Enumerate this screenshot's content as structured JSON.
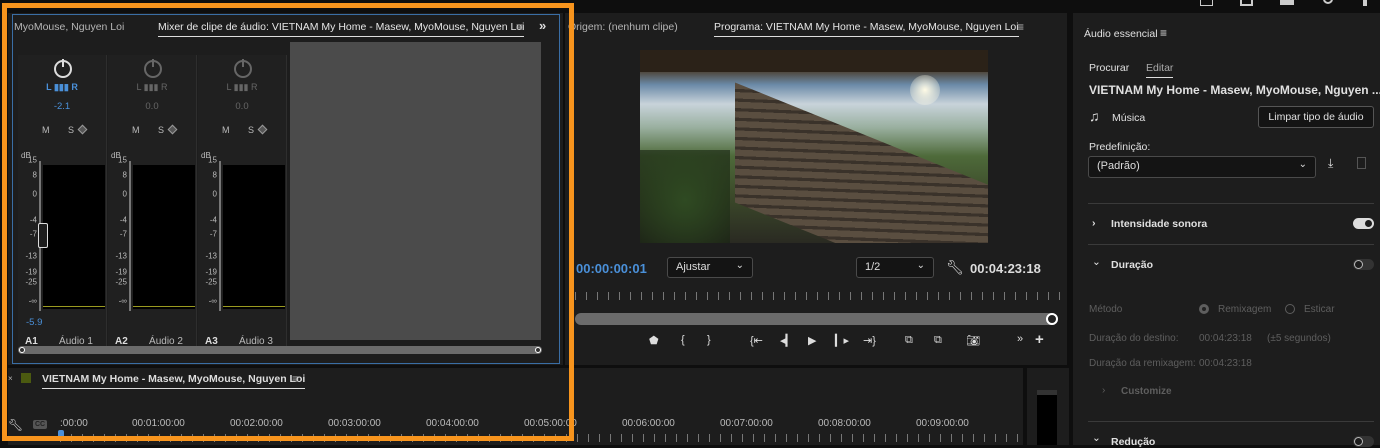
{
  "mixer": {
    "prev_tab": "MyoMouse, Nguyen Loi",
    "active_tab": "Mixer de clipe de áudio: VIETNAM   My Home - Masew, MyoMouse, Nguyen Loi",
    "overflow": "»",
    "db_label": "dB",
    "scale": [
      "15",
      "8",
      "0",
      "-4",
      "-7",
      "-13",
      "-19",
      "-25",
      "-∞"
    ],
    "channels": [
      {
        "id": "A1",
        "name": "Áudio 1",
        "pan": "-2.1",
        "volume": "-5.9",
        "active": true
      },
      {
        "id": "A2",
        "name": "Áudio 2",
        "pan": "0.0",
        "volume": "",
        "active": false
      },
      {
        "id": "A3",
        "name": "Áudio 3",
        "pan": "0.0",
        "volume": "",
        "active": false
      }
    ],
    "lr": "L ▮▮▮ R",
    "ms": "M S"
  },
  "monitor": {
    "source_tab": "Origem: (nenhum clipe)",
    "program_tab": "Programa: VIETNAM   My Home - Masew, MyoMouse, Nguyen Loi",
    "timecode": "00:00:00:01",
    "fit": "Ajustar",
    "resolution": "1/2",
    "duration": "00:04:23:18"
  },
  "timeline": {
    "tab": "VIETNAM   My Home - Masew, MyoMouse, Nguyen Loi",
    "cc": "CC",
    "ruler": [
      ":00:00",
      "00:01:00:00",
      "00:02:00:00",
      "00:03:00:00",
      "00:04:00:00",
      "00:05:00:00",
      "00:06:00:00",
      "00:07:00:00",
      "00:08:00:00",
      "00:09:00:00"
    ]
  },
  "essential": {
    "title": "Áudio essencial",
    "tabs": [
      "Procurar",
      "Editar"
    ],
    "clip": "VIETNAM   My Home - Masew, MyoMouse, Nguyen ...",
    "type": "Música",
    "clear": "Limpar tipo de áudio",
    "preset_label": "Predefinição:",
    "preset": "(Padrão)",
    "sections": {
      "loudness": "Intensidade sonora",
      "duration": "Duração",
      "reduction": "Redução"
    },
    "method_label": "Método",
    "method_options": [
      "Remixagem",
      "Esticar"
    ],
    "target_label": "Duração do destino:",
    "target_value": "00:04:23:18",
    "tolerance": "(±5 segundos)",
    "remix_label": "Duração da remixagem:",
    "remix_value": "00:04:23:18",
    "customize": "Customize"
  },
  "colors": {
    "highlight": "#f7941d",
    "accent": "#4a90d9"
  }
}
